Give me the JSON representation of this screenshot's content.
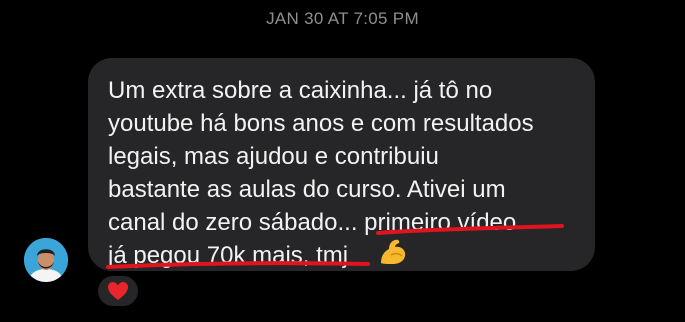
{
  "header": {
    "timestamp": "JAN 30 AT 7:05 PM"
  },
  "message": {
    "text": "Um extra sobre a caixinha... já tô no\nyoutube há bons anos e com resultados\nlegais, mas ajudou e contribuiu\nbastante as aulas do curso. Ativei um\ncanal do zero sábado... primeiro vídeo\njá pegou 70k mais, tmj",
    "trailing_emoji": "flexed-biceps-icon",
    "bubble_color": "#262628",
    "text_color": "#f2f2f2",
    "annotation_color": "#e0141e"
  },
  "reaction": {
    "icon": "heart-icon",
    "color": "#e8242d"
  },
  "sender": {
    "avatar_icon": "avatar"
  }
}
